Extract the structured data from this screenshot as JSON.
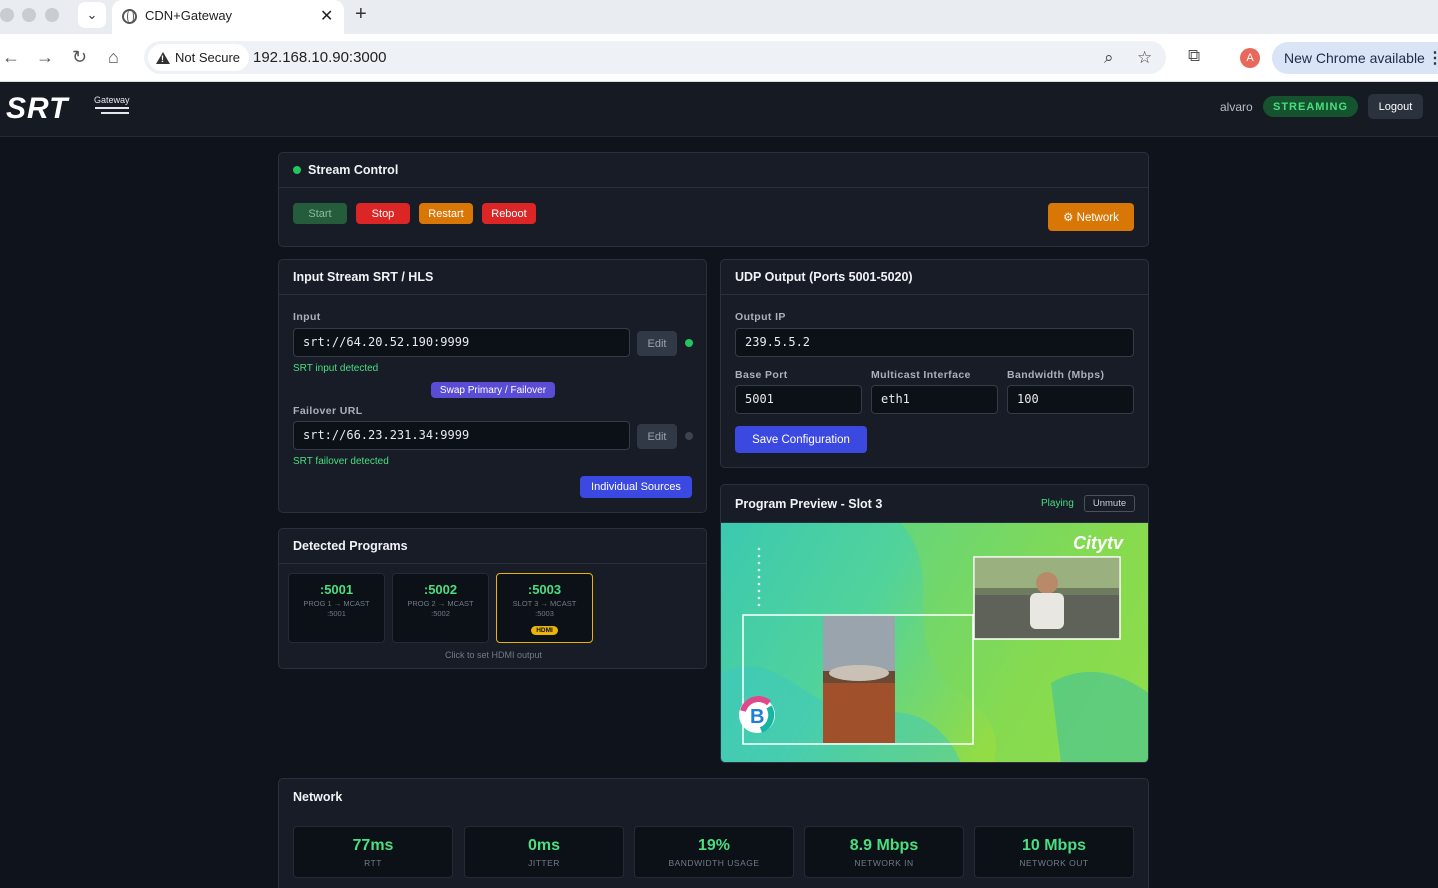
{
  "browser": {
    "tab_title": "CDN+Gateway",
    "security_label": "Not Secure",
    "url": "192.168.10.90:3000",
    "profile_initial": "A",
    "update_label": "New Chrome available"
  },
  "header": {
    "logo_text": "SRT",
    "logo_sub": "Gateway",
    "username": "alvaro",
    "status": "STREAMING",
    "logout_label": "Logout"
  },
  "stream_control": {
    "title": "Stream Control",
    "start_label": "Start",
    "stop_label": "Stop",
    "restart_label": "Restart",
    "reboot_label": "Reboot",
    "network_label": "⚙ Network"
  },
  "input_stream": {
    "title": "Input Stream SRT / HLS",
    "input_label": "Input",
    "input_value": "srt://64.20.52.190:9999",
    "edit_label": "Edit",
    "input_status": "SRT input detected",
    "swap_label": "Swap Primary / Failover",
    "failover_label": "Failover URL",
    "failover_value": "srt://66.23.231.34:9999",
    "failover_status": "SRT failover detected",
    "sources_label": "Individual Sources"
  },
  "programs": {
    "title": "Detected Programs",
    "items": [
      {
        "port": ":5001",
        "desc": "PROG 1 → MCAST :5001"
      },
      {
        "port": ":5002",
        "desc": "PROG 2 → MCAST :5002"
      },
      {
        "port": ":5003",
        "desc": "SLOT 3 → MCAST :5003",
        "badge": "HDMI"
      }
    ],
    "hint": "Click to set HDMI output"
  },
  "udp_output": {
    "title": "UDP Output (Ports 5001-5020)",
    "ip_label": "Output IP",
    "ip_value": "239.5.5.2",
    "port_label": "Base Port",
    "port_value": "5001",
    "iface_label": "Multicast Interface",
    "iface_value": "eth1",
    "bw_label": "Bandwidth (Mbps)",
    "bw_value": "100",
    "save_label": "Save Configuration"
  },
  "preview": {
    "title": "Program Preview - Slot 3",
    "state": "Playing",
    "unmute_label": "Unmute",
    "channel_logo": "Citytv"
  },
  "network": {
    "title": "Network",
    "stats": [
      {
        "value": "77ms",
        "label": "RTT"
      },
      {
        "value": "0ms",
        "label": "JITTER"
      },
      {
        "value": "19%",
        "label": "BANDWIDTH USAGE"
      },
      {
        "value": "8.9 Mbps",
        "label": "NETWORK IN"
      },
      {
        "value": "10 Mbps",
        "label": "NETWORK OUT"
      }
    ]
  },
  "colors": {
    "accent_green": "#4ade80",
    "stop_red": "#dc2626",
    "restart_orange": "#d97706",
    "primary_blue": "#3b49e0",
    "swap_purple": "#5b4cd6"
  }
}
